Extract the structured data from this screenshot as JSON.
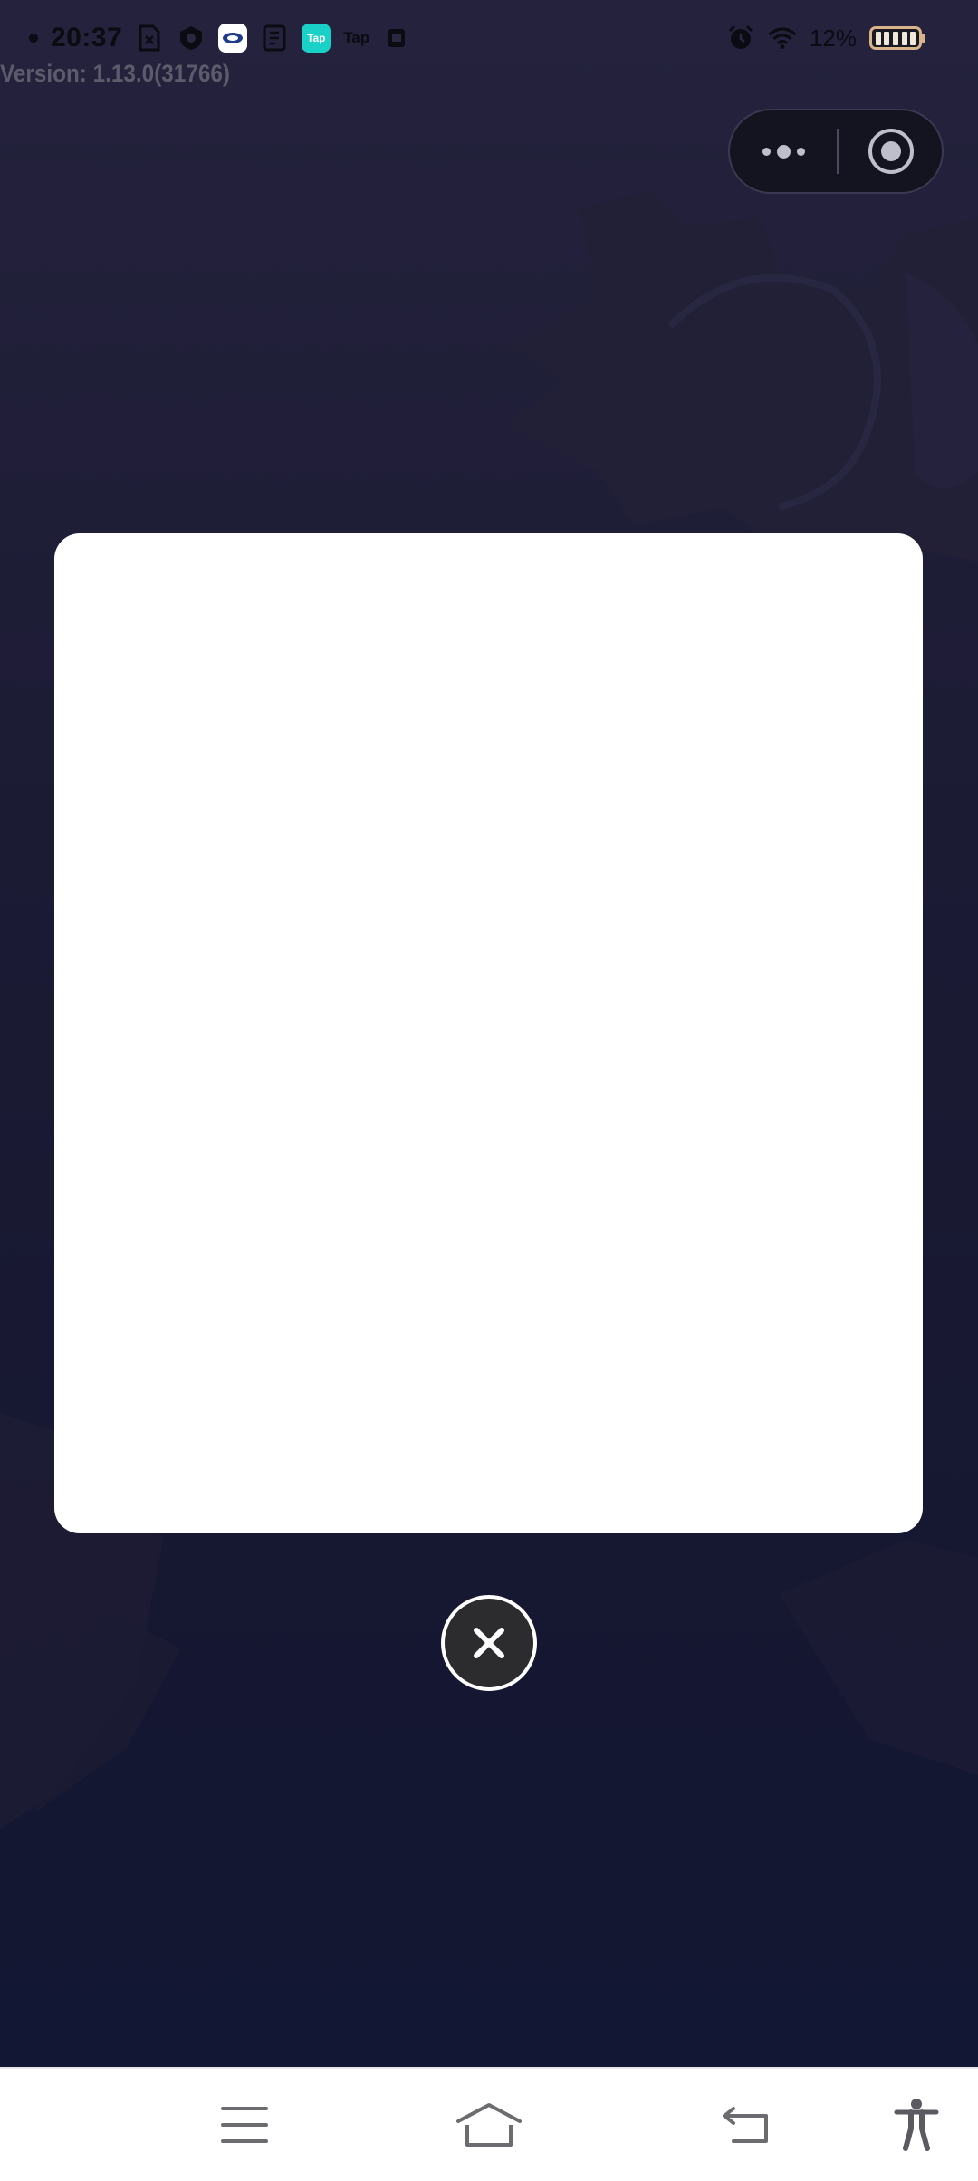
{
  "status_bar": {
    "time": "20:37",
    "battery_percent": "12%",
    "app_tile_tap": "Tap",
    "app_text_tap": "Tap",
    "left_icons": [
      "file-icon",
      "vpn-shield-icon",
      "app-logo-icon",
      "document-app-icon",
      "taptap-app-icon",
      "tap-text-icon",
      "sim-card-icon"
    ],
    "right_icons": [
      "alarm-icon",
      "wifi-icon",
      "battery-icon"
    ]
  },
  "version_label": "Version: 1.13.0(31766)",
  "capsule": {
    "more_icon": "more-dots-icon",
    "close_icon": "target-circle-icon"
  },
  "modal": {
    "close_icon": "close-x-icon"
  },
  "nav_bar": {
    "icons": [
      "menu-icon",
      "home-icon",
      "back-icon",
      "accessibility-icon"
    ]
  },
  "colors": {
    "background_top": "#24223c",
    "background_bottom": "#121733",
    "modal_card": "#ffffff",
    "close_button_fill": "#2c2c2f",
    "nav_bar": "#ffffff"
  }
}
